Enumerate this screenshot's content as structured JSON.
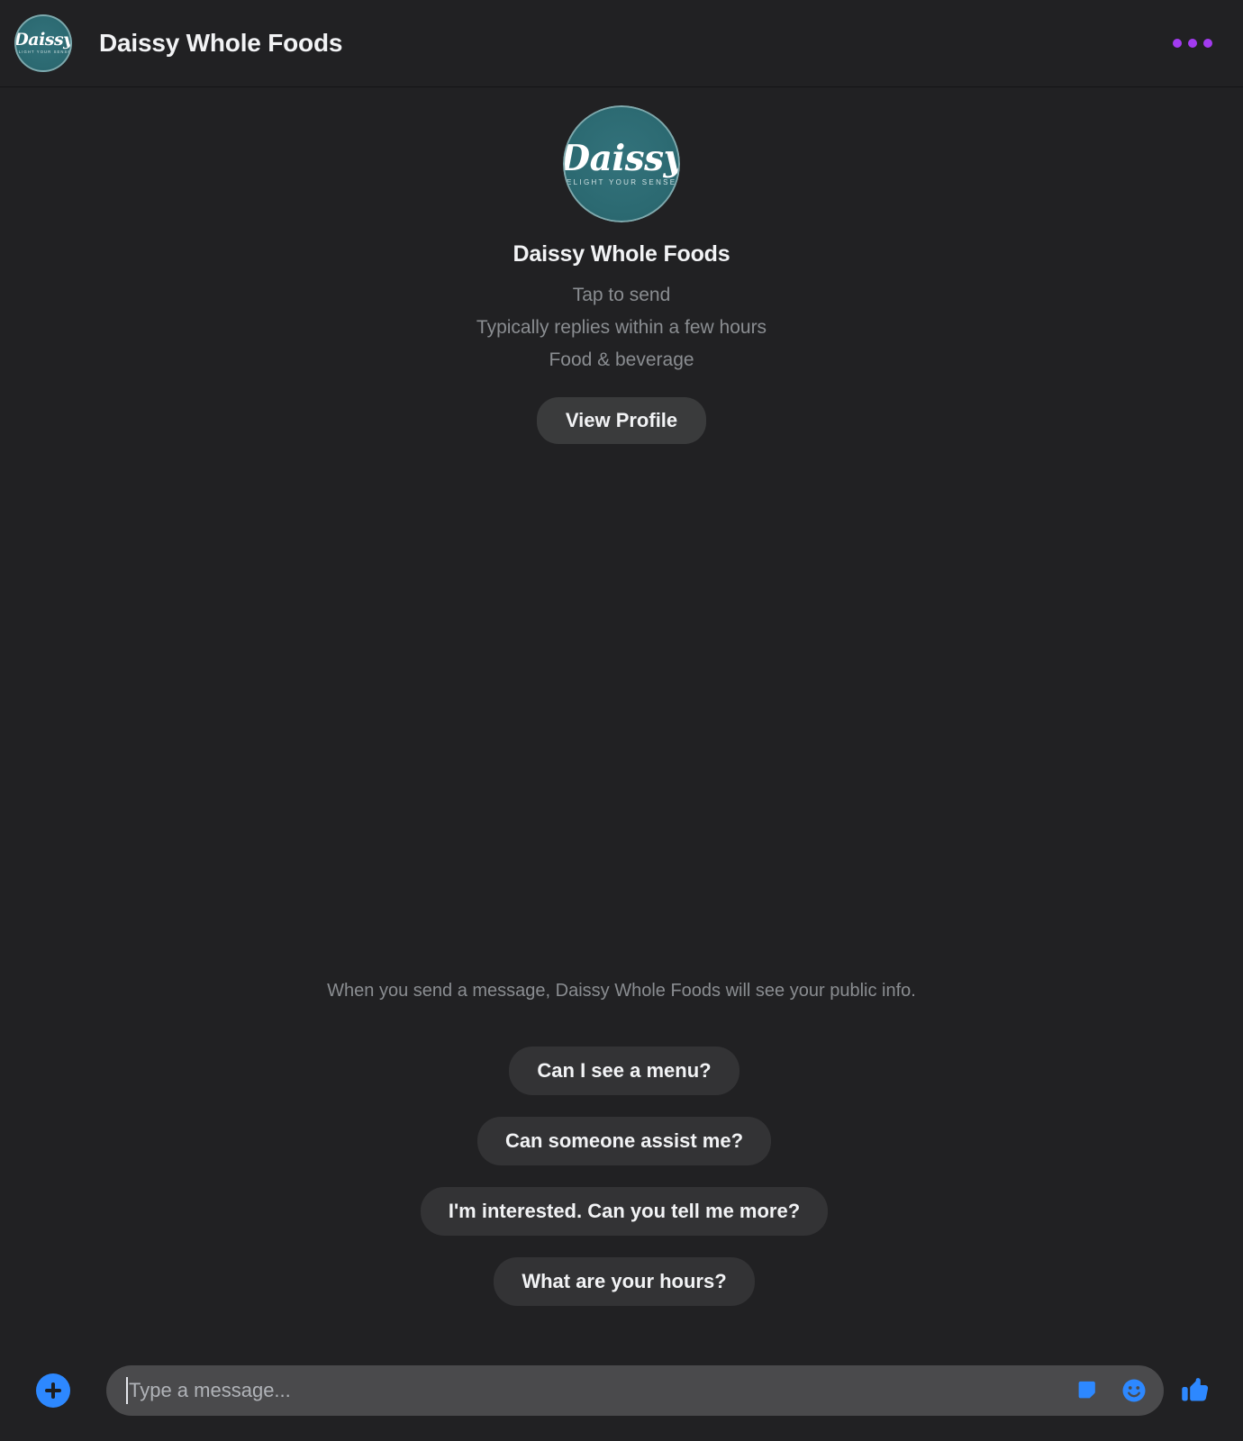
{
  "header": {
    "title": "Daissy Whole Foods",
    "avatar_name": "avatar",
    "logo": {
      "script_text": "Daissy",
      "tagline": "Delight Your Senses"
    },
    "menu_label": "More options"
  },
  "profile": {
    "name": "Daissy Whole Foods",
    "tap_to_send": "Tap to send",
    "response_time": "Typically replies within a few hours",
    "category": "Food & beverage",
    "view_profile_label": "View Profile"
  },
  "thread": {
    "privacy_note": "When you send a message, Daissy Whole Foods will see your public info.",
    "quick_replies": [
      {
        "label": "Can I see a menu?"
      },
      {
        "label": "Can someone assist me?"
      },
      {
        "label": "I'm interested. Can you tell me more?"
      },
      {
        "label": "What are your hours?"
      }
    ]
  },
  "composer": {
    "add_label": "Add attachment",
    "input_value": "",
    "placeholder": "Type a message...",
    "sticker_label": "Sticker",
    "emoji_label": "Emoji",
    "like_label": "Send like"
  },
  "colors": {
    "page_background": "#212123",
    "header_background": "#212123",
    "bubble_background": "#333335",
    "button_background": "#3a3b3c",
    "input_background": "#4a4a4c",
    "accent_blue": "#2d88ff",
    "menu_purple": "#a33bf0",
    "logo_teal": "#2c6a72",
    "primary_text": "#f2f3f5",
    "secondary_text": "#8a8d91"
  }
}
